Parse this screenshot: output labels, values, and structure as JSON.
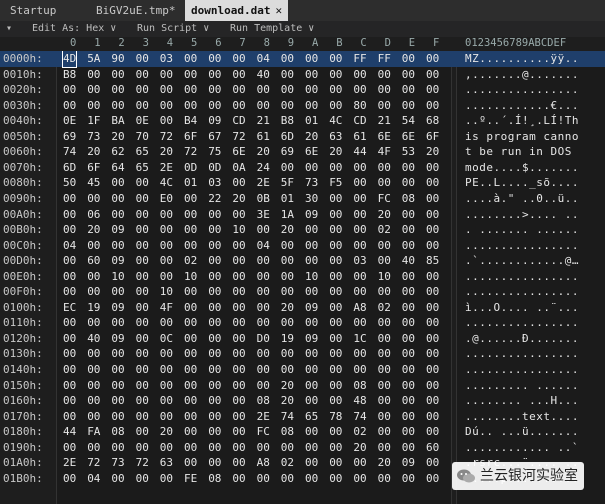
{
  "tabs": [
    {
      "label": "Startup",
      "active": false
    },
    {
      "label": "BiGV2uE.tmp*",
      "active": false
    },
    {
      "label": "download.dat",
      "active": true,
      "close": "✕"
    }
  ],
  "toolbar": {
    "menu_icon": "▾",
    "edit_as": "Edit As: Hex ∨",
    "run_script": "Run Script ∨",
    "run_template": "Run Template ∨"
  },
  "column_header": {
    "hex_cols": [
      "0",
      "1",
      "2",
      "3",
      "4",
      "5",
      "6",
      "7",
      "8",
      "9",
      "A",
      "B",
      "C",
      "D",
      "E",
      "F"
    ],
    "ascii_cols": "0123456789ABCDEF"
  },
  "rows": [
    {
      "addr": "0000h:",
      "bytes": [
        "4D",
        "5A",
        "90",
        "00",
        "03",
        "00",
        "00",
        "00",
        "04",
        "00",
        "00",
        "00",
        "FF",
        "FF",
        "00",
        "00"
      ],
      "ascii": "MZ..........ÿÿ.."
    },
    {
      "addr": "0010h:",
      "bytes": [
        "B8",
        "00",
        "00",
        "00",
        "00",
        "00",
        "00",
        "00",
        "40",
        "00",
        "00",
        "00",
        "00",
        "00",
        "00",
        "00"
      ],
      "ascii": ",.......@......."
    },
    {
      "addr": "0020h:",
      "bytes": [
        "00",
        "00",
        "00",
        "00",
        "00",
        "00",
        "00",
        "00",
        "00",
        "00",
        "00",
        "00",
        "00",
        "00",
        "00",
        "00"
      ],
      "ascii": "................"
    },
    {
      "addr": "0030h:",
      "bytes": [
        "00",
        "00",
        "00",
        "00",
        "00",
        "00",
        "00",
        "00",
        "00",
        "00",
        "00",
        "00",
        "80",
        "00",
        "00",
        "00"
      ],
      "ascii": "............€..."
    },
    {
      "addr": "0040h:",
      "bytes": [
        "0E",
        "1F",
        "BA",
        "0E",
        "00",
        "B4",
        "09",
        "CD",
        "21",
        "B8",
        "01",
        "4C",
        "CD",
        "21",
        "54",
        "68"
      ],
      "ascii": "..º..´.Í!¸.LÍ!Th"
    },
    {
      "addr": "0050h:",
      "bytes": [
        "69",
        "73",
        "20",
        "70",
        "72",
        "6F",
        "67",
        "72",
        "61",
        "6D",
        "20",
        "63",
        "61",
        "6E",
        "6E",
        "6F"
      ],
      "ascii": "is program canno"
    },
    {
      "addr": "0060h:",
      "bytes": [
        "74",
        "20",
        "62",
        "65",
        "20",
        "72",
        "75",
        "6E",
        "20",
        "69",
        "6E",
        "20",
        "44",
        "4F",
        "53",
        "20"
      ],
      "ascii": "t be run in DOS "
    },
    {
      "addr": "0070h:",
      "bytes": [
        "6D",
        "6F",
        "64",
        "65",
        "2E",
        "0D",
        "0D",
        "0A",
        "24",
        "00",
        "00",
        "00",
        "00",
        "00",
        "00",
        "00"
      ],
      "ascii": "mode....$......."
    },
    {
      "addr": "0080h:",
      "bytes": [
        "50",
        "45",
        "00",
        "00",
        "4C",
        "01",
        "03",
        "00",
        "2E",
        "5F",
        "73",
        "F5",
        "00",
        "00",
        "00",
        "00"
      ],
      "ascii": "PE..L...._sõ...."
    },
    {
      "addr": "0090h:",
      "bytes": [
        "00",
        "00",
        "00",
        "00",
        "E0",
        "00",
        "22",
        "20",
        "0B",
        "01",
        "30",
        "00",
        "00",
        "FC",
        "08",
        "00"
      ],
      "ascii": "....à.\" ..0..ü.."
    },
    {
      "addr": "00A0h:",
      "bytes": [
        "00",
        "06",
        "00",
        "00",
        "00",
        "00",
        "00",
        "00",
        "3E",
        "1A",
        "09",
        "00",
        "00",
        "20",
        "00",
        "00"
      ],
      "ascii": "........>.... .."
    },
    {
      "addr": "00B0h:",
      "bytes": [
        "00",
        "20",
        "09",
        "00",
        "00",
        "00",
        "00",
        "10",
        "00",
        "20",
        "00",
        "00",
        "00",
        "02",
        "00",
        "00"
      ],
      "ascii": ". ....... ......"
    },
    {
      "addr": "00C0h:",
      "bytes": [
        "04",
        "00",
        "00",
        "00",
        "00",
        "00",
        "00",
        "00",
        "04",
        "00",
        "00",
        "00",
        "00",
        "00",
        "00",
        "00"
      ],
      "ascii": "................"
    },
    {
      "addr": "00D0h:",
      "bytes": [
        "00",
        "60",
        "09",
        "00",
        "00",
        "02",
        "00",
        "00",
        "00",
        "00",
        "00",
        "00",
        "03",
        "00",
        "40",
        "85"
      ],
      "ascii": ".`............@…"
    },
    {
      "addr": "00E0h:",
      "bytes": [
        "00",
        "00",
        "10",
        "00",
        "00",
        "10",
        "00",
        "00",
        "00",
        "00",
        "10",
        "00",
        "00",
        "10",
        "00",
        "00"
      ],
      "ascii": "................"
    },
    {
      "addr": "00F0h:",
      "bytes": [
        "00",
        "00",
        "00",
        "00",
        "10",
        "00",
        "00",
        "00",
        "00",
        "00",
        "00",
        "00",
        "00",
        "00",
        "00",
        "00"
      ],
      "ascii": "................"
    },
    {
      "addr": "0100h:",
      "bytes": [
        "EC",
        "19",
        "09",
        "00",
        "4F",
        "00",
        "00",
        "00",
        "00",
        "20",
        "09",
        "00",
        "A8",
        "02",
        "00",
        "00"
      ],
      "ascii": "ì...O.... ..¨..."
    },
    {
      "addr": "0110h:",
      "bytes": [
        "00",
        "00",
        "00",
        "00",
        "00",
        "00",
        "00",
        "00",
        "00",
        "00",
        "00",
        "00",
        "00",
        "00",
        "00",
        "00"
      ],
      "ascii": "................"
    },
    {
      "addr": "0120h:",
      "bytes": [
        "00",
        "40",
        "09",
        "00",
        "0C",
        "00",
        "00",
        "00",
        "D0",
        "19",
        "09",
        "00",
        "1C",
        "00",
        "00",
        "00"
      ],
      "ascii": ".@......Ð......."
    },
    {
      "addr": "0130h:",
      "bytes": [
        "00",
        "00",
        "00",
        "00",
        "00",
        "00",
        "00",
        "00",
        "00",
        "00",
        "00",
        "00",
        "00",
        "00",
        "00",
        "00"
      ],
      "ascii": "................"
    },
    {
      "addr": "0140h:",
      "bytes": [
        "00",
        "00",
        "00",
        "00",
        "00",
        "00",
        "00",
        "00",
        "00",
        "00",
        "00",
        "00",
        "00",
        "00",
        "00",
        "00"
      ],
      "ascii": "................"
    },
    {
      "addr": "0150h:",
      "bytes": [
        "00",
        "00",
        "00",
        "00",
        "00",
        "00",
        "00",
        "00",
        "00",
        "20",
        "00",
        "00",
        "08",
        "00",
        "00",
        "00"
      ],
      "ascii": "......... ......"
    },
    {
      "addr": "0160h:",
      "bytes": [
        "00",
        "00",
        "00",
        "00",
        "00",
        "00",
        "00",
        "00",
        "08",
        "20",
        "00",
        "00",
        "48",
        "00",
        "00",
        "00"
      ],
      "ascii": "........ ...H..."
    },
    {
      "addr": "0170h:",
      "bytes": [
        "00",
        "00",
        "00",
        "00",
        "00",
        "00",
        "00",
        "00",
        "2E",
        "74",
        "65",
        "78",
        "74",
        "00",
        "00",
        "00"
      ],
      "ascii": "........text...."
    },
    {
      "addr": "0180h:",
      "bytes": [
        "44",
        "FA",
        "08",
        "00",
        "20",
        "00",
        "00",
        "00",
        "FC",
        "08",
        "00",
        "00",
        "02",
        "00",
        "00",
        "00"
      ],
      "ascii": "Dú.. ...ü......."
    },
    {
      "addr": "0190h:",
      "bytes": [
        "00",
        "00",
        "00",
        "00",
        "00",
        "00",
        "00",
        "00",
        "00",
        "00",
        "00",
        "00",
        "20",
        "00",
        "00",
        "60"
      ],
      "ascii": "............ ..`"
    },
    {
      "addr": "01A0h:",
      "bytes": [
        "2E",
        "72",
        "73",
        "72",
        "63",
        "00",
        "00",
        "00",
        "A8",
        "02",
        "00",
        "00",
        "00",
        "20",
        "09",
        "00"
      ],
      "ascii": ".rsrc...¨.... .."
    },
    {
      "addr": "01B0h:",
      "bytes": [
        "00",
        "04",
        "00",
        "00",
        "00",
        "FE",
        "08",
        "00",
        "00",
        "00",
        "00",
        "00",
        "00",
        "00",
        "00",
        "00"
      ],
      "ascii": ".....þ.........."
    }
  ],
  "watermark": {
    "text": "兰云银河实验室"
  }
}
